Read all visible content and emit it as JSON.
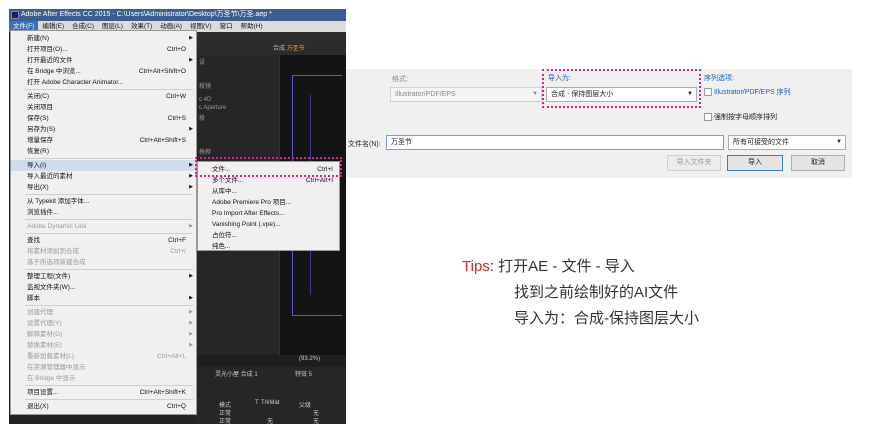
{
  "window": {
    "title": "Adobe After Effects CC 2015 - C:\\Users\\Administrator\\Desktop\\万圣节\\万圣.aep *"
  },
  "menubar": [
    "文件(F)",
    "编辑(E)",
    "合成(C)",
    "图层(L)",
    "效果(T)",
    "动画(A)",
    "视图(V)",
    "窗口",
    "帮助(H)"
  ],
  "file_menu": [
    {
      "label": "新建(N)",
      "shortcut": "",
      "arrow": true,
      "disabled": false
    },
    {
      "label": "打开项目(O)...",
      "shortcut": "Ctrl+O",
      "arrow": false,
      "disabled": false
    },
    {
      "label": "打开最近的文件",
      "shortcut": "",
      "arrow": true,
      "disabled": false
    },
    {
      "label": "在 Bridge 中浏览...",
      "shortcut": "Ctrl+Alt+Shift+O",
      "arrow": false,
      "disabled": false
    },
    {
      "label": "打开 Adobe Character Animator...",
      "shortcut": "",
      "arrow": false,
      "disabled": false
    },
    {
      "label": "关闭(C)",
      "shortcut": "Ctrl+W",
      "arrow": false,
      "disabled": false
    },
    {
      "label": "关闭项目",
      "shortcut": "",
      "arrow": false,
      "disabled": false
    },
    {
      "label": "保存(S)",
      "shortcut": "Ctrl+S",
      "arrow": false,
      "disabled": false
    },
    {
      "label": "另存为(S)",
      "shortcut": "",
      "arrow": true,
      "disabled": false
    },
    {
      "label": "增量保存",
      "shortcut": "Ctrl+Alt+Shift+S",
      "arrow": false,
      "disabled": false
    },
    {
      "label": "恢复(R)",
      "shortcut": "",
      "arrow": false,
      "disabled": false
    },
    {
      "label": "导入(I)",
      "shortcut": "",
      "arrow": true,
      "disabled": false
    },
    {
      "label": "导入最近的素材",
      "shortcut": "",
      "arrow": true,
      "disabled": false
    },
    {
      "label": "导出(X)",
      "shortcut": "",
      "arrow": true,
      "disabled": false
    },
    {
      "label": "从 Typekit 添加字体...",
      "shortcut": "",
      "arrow": false,
      "disabled": false
    },
    {
      "label": "浏览插件...",
      "shortcut": "",
      "arrow": false,
      "disabled": false
    },
    {
      "label": "Adobe Dynamic Link",
      "shortcut": "",
      "arrow": true,
      "disabled": true
    },
    {
      "label": "查找",
      "shortcut": "Ctrl+F",
      "arrow": false,
      "disabled": false
    },
    {
      "label": "将素材添加到合成",
      "shortcut": "Ctrl+/",
      "arrow": false,
      "disabled": true
    },
    {
      "label": "基于所选项新建合成",
      "shortcut": "",
      "arrow": false,
      "disabled": true
    },
    {
      "label": "整理工程(文件)",
      "shortcut": "",
      "arrow": true,
      "disabled": false
    },
    {
      "label": "监视文件夹(W)...",
      "shortcut": "",
      "arrow": false,
      "disabled": false
    },
    {
      "label": "脚本",
      "shortcut": "",
      "arrow": true,
      "disabled": false
    },
    {
      "label": "创建代理",
      "shortcut": "",
      "arrow": true,
      "disabled": true
    },
    {
      "label": "设置代理(Y)",
      "shortcut": "",
      "arrow": true,
      "disabled": true
    },
    {
      "label": "解释素材(G)",
      "shortcut": "",
      "arrow": true,
      "disabled": true
    },
    {
      "label": "替换素材(E)",
      "shortcut": "",
      "arrow": true,
      "disabled": true
    },
    {
      "label": "重新加载素材(L)",
      "shortcut": "Ctrl+Alt+L",
      "arrow": false,
      "disabled": true
    },
    {
      "label": "在资源管理器中显示",
      "shortcut": "",
      "arrow": false,
      "disabled": true
    },
    {
      "label": "在 Bridge 中显示",
      "shortcut": "",
      "arrow": false,
      "disabled": true
    },
    {
      "label": "项目设置...",
      "shortcut": "Ctrl+Alt+Shift+K",
      "arrow": false,
      "disabled": false
    },
    {
      "label": "退出(X)",
      "shortcut": "Ctrl+Q",
      "arrow": false,
      "disabled": false
    }
  ],
  "import_submenu": [
    {
      "label": "文件...",
      "shortcut": "Ctrl+I",
      "disabled": false
    },
    {
      "label": "多个文件...",
      "shortcut": "Ctrl+Alt+I",
      "disabled": false
    },
    {
      "label": "从库中...",
      "shortcut": "",
      "disabled": false
    },
    {
      "label": "Adobe Premiere Pro 项目...",
      "shortcut": "",
      "disabled": false
    },
    {
      "label": "Pro Import After Effects...",
      "shortcut": "",
      "disabled": false
    },
    {
      "label": "Vanishing Point (.vpe)...",
      "shortcut": "",
      "disabled": false
    },
    {
      "label": "占位符...",
      "shortcut": "",
      "disabled": false
    },
    {
      "label": "纯色...",
      "shortcut": "",
      "disabled": false
    }
  ],
  "ae_panels": {
    "comp_header": "合成",
    "comp_name": "万圣节",
    "left_labels": [
      "设",
      "棱镜",
      "c 4D",
      "c Aperture",
      "棱",
      "梅桦"
    ],
    "zoom": "(93.2%)",
    "timeline_tabs": [
      "灵光小屋 合成 1",
      "特效 5"
    ],
    "timeline_cols": [
      "模式",
      "T",
      "TrkMat",
      "父级"
    ],
    "timeline_rows": [
      {
        "mode": "正常",
        "trkmat": "",
        "parent": "无"
      },
      {
        "mode": "正常",
        "trkmat": "无",
        "parent": "无"
      },
      {
        "mode": "正常",
        "trkmat": "无",
        "parent": "无"
      }
    ]
  },
  "dialog": {
    "format_label": "格式:",
    "format_value": "Illustrator/PDF/EPS",
    "import_as_label": "导入为:",
    "import_as_value": "合成 - 保持图层大小",
    "sequence_label": "序列选项:",
    "sequence_checkbox": "Illustrator/PDF/EPS 序列",
    "alpha_checkbox": "强制按字母顺序排列",
    "filename_label": "文件名(N):",
    "filename_value": "万圣节",
    "filetype_value": "所有可接受的文件",
    "import_folder_button": "导入文件夹",
    "import_button": "导入",
    "cancel_button": "取消"
  },
  "tips": {
    "label": "Tips",
    "colon": ":",
    "line1": "打开AE - 文件 - 导入",
    "line2": "找到之前绘制好的AI文件",
    "line3": "导入为：合成-保持图层大小"
  },
  "colors": {
    "highlight": "#e0208a",
    "tips_red": "#e0281f",
    "link_blue": "#1a5fb4"
  }
}
